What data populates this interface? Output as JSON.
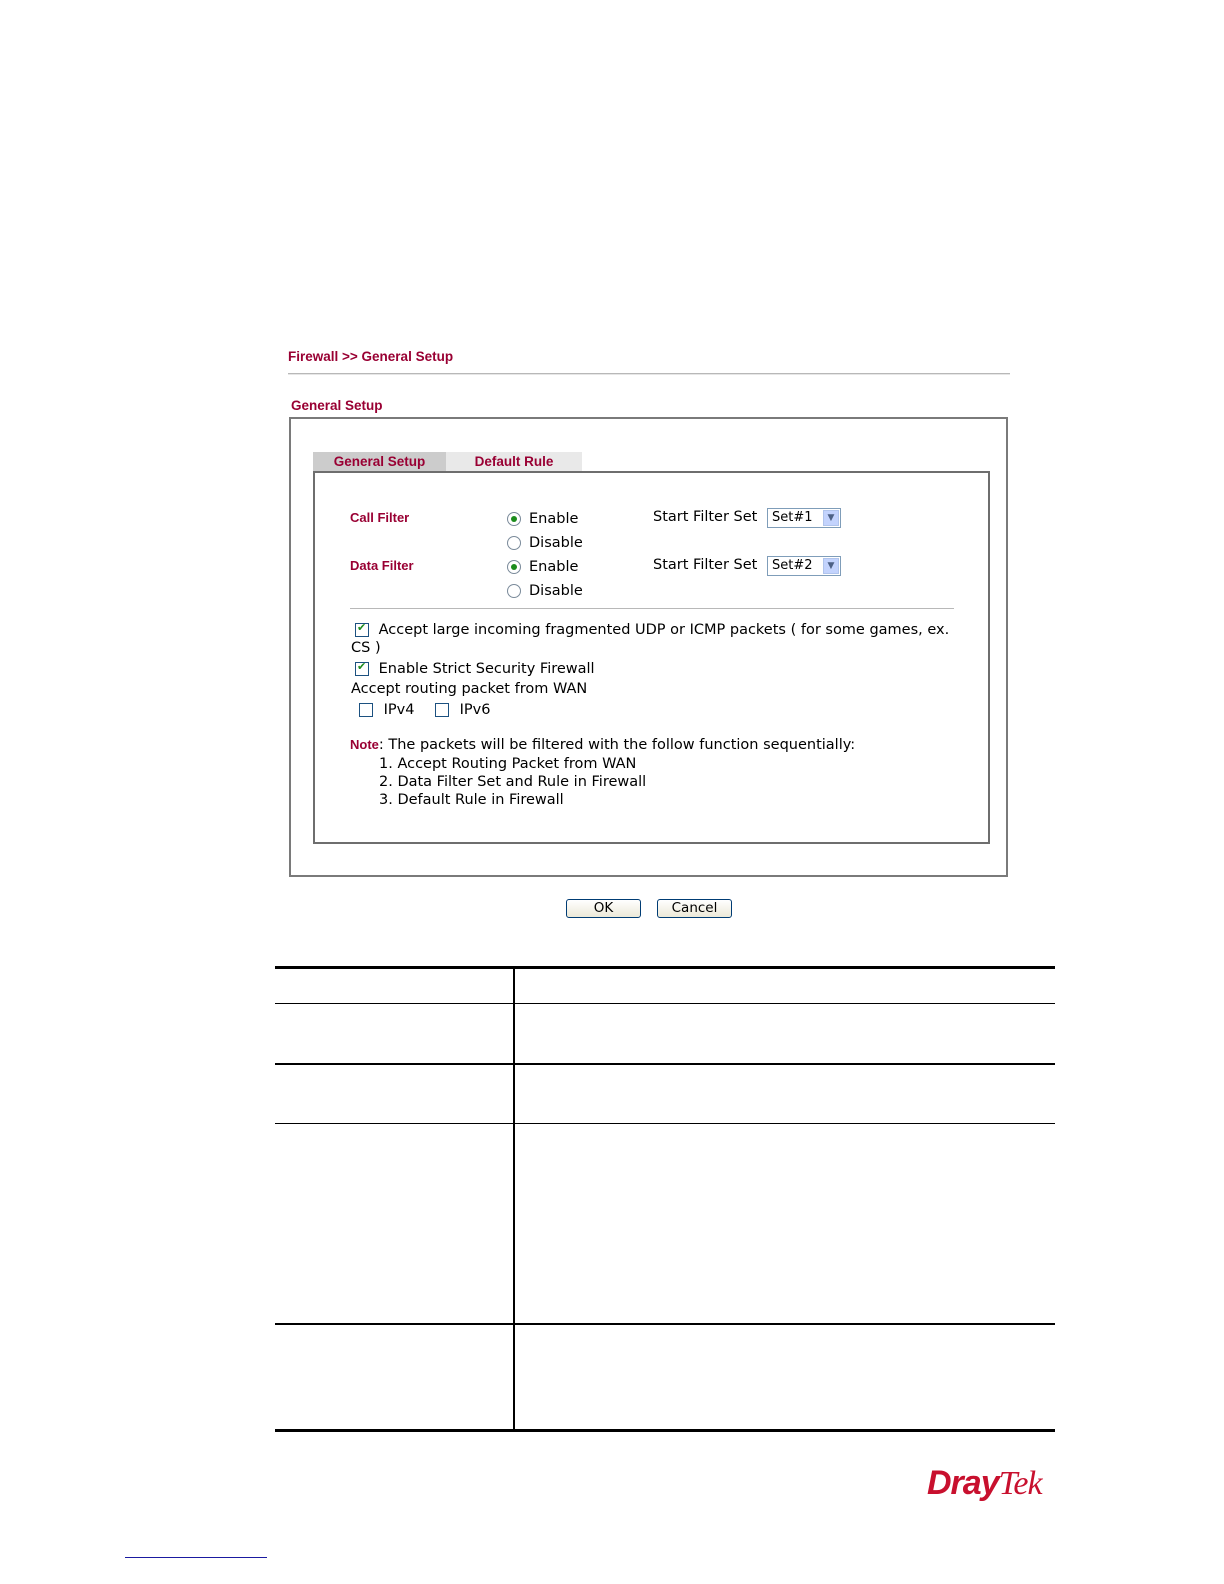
{
  "breadcrumb": "Firewall >> General Setup",
  "section_title": "General Setup",
  "tabs": [
    {
      "label": "General Setup",
      "active": true
    },
    {
      "label": "Default Rule",
      "active": false
    }
  ],
  "call_filter": {
    "label": "Call Filter",
    "enable_label": "Enable",
    "disable_label": "Disable",
    "selected": "Enable",
    "start_filter_label": "Start Filter Set",
    "start_filter_value": "Set#1"
  },
  "data_filter": {
    "label": "Data Filter",
    "enable_label": "Enable",
    "disable_label": "Disable",
    "selected": "Enable",
    "start_filter_label": "Start Filter Set",
    "start_filter_value": "Set#2"
  },
  "options": {
    "accept_fragmented_line1": "Accept large incoming fragmented UDP or ICMP packets ( for some games, ex.",
    "accept_fragmented_line2": "CS )",
    "accept_fragmented_checked": true,
    "strict_firewall": "Enable Strict Security Firewall",
    "strict_firewall_checked": true,
    "routing_label": "Accept routing packet from WAN",
    "ipv4": "IPv4",
    "ipv4_checked": false,
    "ipv6": "IPv6",
    "ipv6_checked": false
  },
  "note": {
    "label": "Note",
    "text": ": The packets will be filtered with the follow function sequentially:",
    "items": [
      "1. Accept Routing Packet from WAN",
      "2. Data Filter Set and Rule in Firewall",
      "3. Default Rule in Firewall"
    ]
  },
  "buttons": {
    "ok": "OK",
    "cancel": "Cancel"
  },
  "logo": {
    "part1": "Dray",
    "part2": "Tek",
    "color": "#c8102e"
  },
  "colors": {
    "accent": "#990033",
    "radio_dot": "#1c8c1c"
  }
}
